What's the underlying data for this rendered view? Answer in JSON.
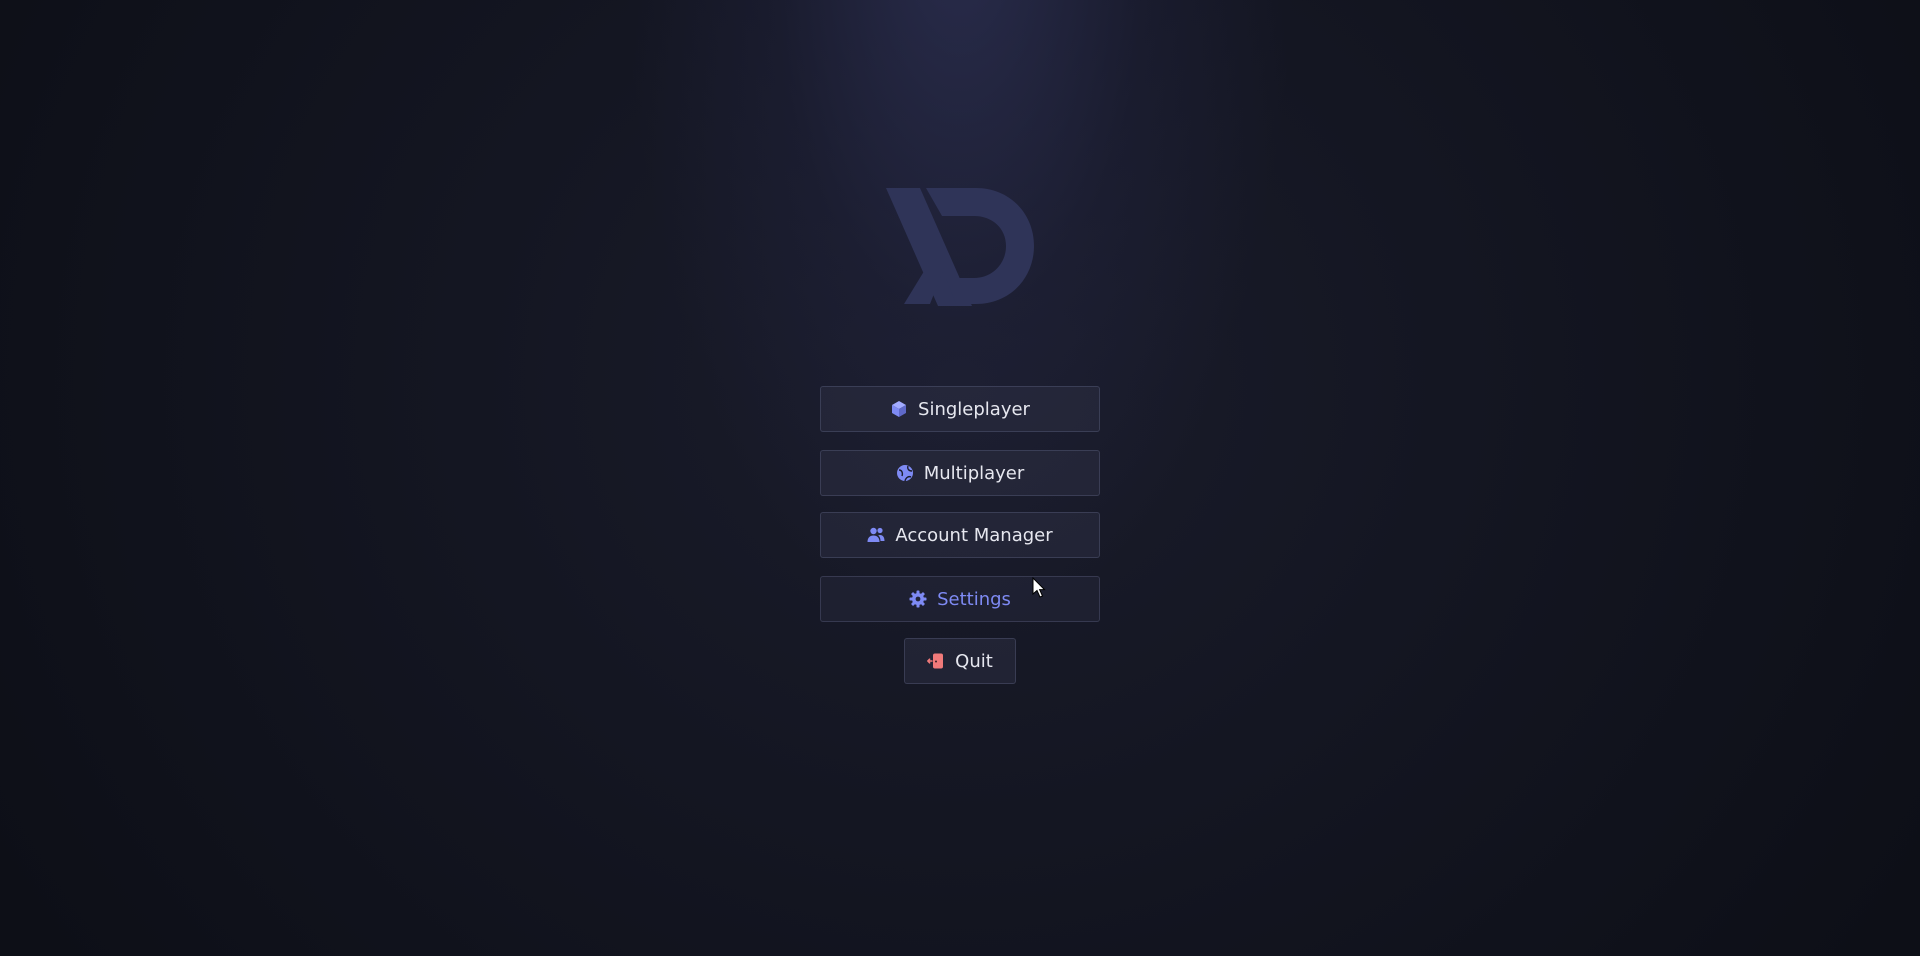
{
  "colors": {
    "accent": "#7e8af4",
    "logo": "#2f3458",
    "button_text": "#e6e7ef",
    "quit_icon": "#f07a7a"
  },
  "logo": {
    "icon": "xd-logo"
  },
  "menu": {
    "singleplayer": {
      "label": "Singleplayer",
      "icon": "cube-icon"
    },
    "multiplayer": {
      "label": "Multiplayer",
      "icon": "globe-icon"
    },
    "account_manager": {
      "label": "Account Manager",
      "icon": "users-icon"
    },
    "settings": {
      "label": "Settings",
      "icon": "gear-icon",
      "state": "hovered"
    },
    "quit": {
      "label": "Quit",
      "icon": "door-exit-icon"
    }
  }
}
